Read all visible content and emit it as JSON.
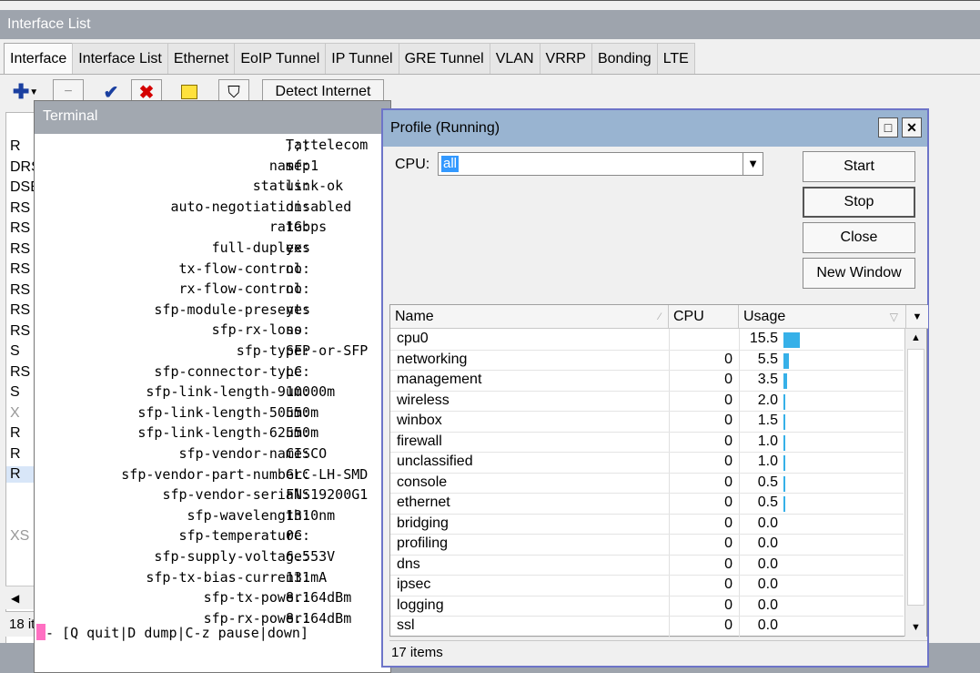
{
  "interface_window": {
    "title": "Interface List",
    "tabs": [
      "Interface",
      "Interface List",
      "Ethernet",
      "EoIP Tunnel",
      "IP Tunnel",
      "GRE Tunnel",
      "VLAN",
      "VRRP",
      "Bonding",
      "LTE"
    ],
    "toolbar": {
      "detect_label": "Detect Internet"
    },
    "flags": [
      "R",
      "DRS",
      "DSE",
      "RS",
      "RS",
      "RS",
      "RS",
      "RS",
      "RS",
      "RS",
      "S",
      "RS",
      "S",
      "X",
      "R",
      "R",
      "R",
      "",
      "",
      "XS"
    ],
    "status": "18 it"
  },
  "terminal": {
    "title": "Terminal",
    "lines": [
      {
        "key": ";;;",
        "value": "Tattelecom"
      },
      {
        "key": "name:",
        "value": "sfp1"
      },
      {
        "key": "status:",
        "value": "link-ok"
      },
      {
        "key": "auto-negotiation:",
        "value": "disabled"
      },
      {
        "key": "rate:",
        "value": "1Gbps"
      },
      {
        "key": "full-duplex:",
        "value": "yes"
      },
      {
        "key": "tx-flow-control:",
        "value": "no"
      },
      {
        "key": "rx-flow-control:",
        "value": "no"
      },
      {
        "key": "sfp-module-present:",
        "value": "yes"
      },
      {
        "key": "sfp-rx-loss:",
        "value": "no"
      },
      {
        "key": "sfp-type:",
        "value": "SFP-or-SFP"
      },
      {
        "key": "sfp-connector-type:",
        "value": "LC"
      },
      {
        "key": "sfp-link-length-9um:",
        "value": "10000m"
      },
      {
        "key": "sfp-link-length-50um:",
        "value": "550m"
      },
      {
        "key": "sfp-link-length-62um:",
        "value": "550m"
      },
      {
        "key": "sfp-vendor-name:",
        "value": "CISCO"
      },
      {
        "key": "sfp-vendor-part-number:",
        "value": "GLC-LH-SMD"
      },
      {
        "key": "sfp-vendor-serial:",
        "value": "FNS19200G1"
      },
      {
        "key": "sfp-wavelength:",
        "value": "1310nm"
      },
      {
        "key": "sfp-temperature:",
        "value": "0C"
      },
      {
        "key": "sfp-supply-voltage:",
        "value": "6.553V"
      },
      {
        "key": "sfp-tx-bias-current:",
        "value": "131mA"
      },
      {
        "key": "sfp-tx-power:",
        "value": "8.164dBm"
      },
      {
        "key": "sfp-rx-power:",
        "value": "8.164dBm"
      }
    ],
    "prompt": "- [Q quit|D dump|C-z pause|down]"
  },
  "profile": {
    "title": "Profile (Running)",
    "cpu_label": "CPU:",
    "cpu_value": "all",
    "buttons": {
      "start": "Start",
      "stop": "Stop",
      "close": "Close",
      "new_window": "New Window"
    },
    "columns": {
      "name": "Name",
      "cpu": "CPU",
      "usage": "Usage"
    },
    "rows": [
      {
        "name": "cpu0",
        "cpu": "",
        "usage": "15.5"
      },
      {
        "name": "networking",
        "cpu": "0",
        "usage": "5.5"
      },
      {
        "name": "management",
        "cpu": "0",
        "usage": "3.5"
      },
      {
        "name": "wireless",
        "cpu": "0",
        "usage": "2.0"
      },
      {
        "name": "winbox",
        "cpu": "0",
        "usage": "1.5"
      },
      {
        "name": "firewall",
        "cpu": "0",
        "usage": "1.0"
      },
      {
        "name": "unclassified",
        "cpu": "0",
        "usage": "1.0"
      },
      {
        "name": "console",
        "cpu": "0",
        "usage": "0.5"
      },
      {
        "name": "ethernet",
        "cpu": "0",
        "usage": "0.5"
      },
      {
        "name": "bridging",
        "cpu": "0",
        "usage": "0.0"
      },
      {
        "name": "profiling",
        "cpu": "0",
        "usage": "0.0"
      },
      {
        "name": "dns",
        "cpu": "0",
        "usage": "0.0"
      },
      {
        "name": "ipsec",
        "cpu": "0",
        "usage": "0.0"
      },
      {
        "name": "logging",
        "cpu": "0",
        "usage": "0.0"
      },
      {
        "name": "ssl",
        "cpu": "0",
        "usage": "0.0"
      }
    ],
    "status": "17 items",
    "bar_color": "#36b0e8"
  }
}
